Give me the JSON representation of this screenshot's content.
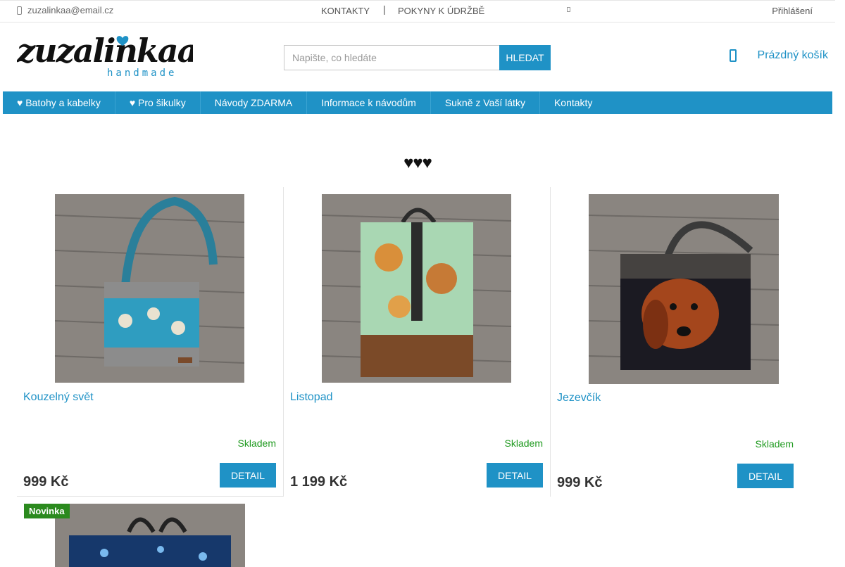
{
  "topbar": {
    "email": "zuzalinkaa@email.cz",
    "link_contacts": "KONTAKTY",
    "separator": "|",
    "link_care": "POKYNY K ÚDRŽBĚ",
    "login": "Přihlášení"
  },
  "header": {
    "logo_text": "zuzalinkaa",
    "logo_subtext": "handmade",
    "search_placeholder": "Napište, co hledáte",
    "search_button": "HLEDAT",
    "cart_label": "Prázdný košík"
  },
  "nav": {
    "items": [
      "♥ Batohy a kabelky",
      "♥ Pro šikulky",
      "Návody ZDARMA",
      "Informace k návodům",
      "Sukně z Vaší látky",
      "Kontakty"
    ]
  },
  "section_heading": "♥♥♥",
  "products": [
    {
      "title": "Kouzelný svět",
      "stock": "Skladem",
      "price": "999 Kč",
      "button": "DETAIL"
    },
    {
      "title": "Listopad",
      "stock": "Skladem",
      "price": "1 199 Kč",
      "button": "DETAIL"
    },
    {
      "title": "Jezevčík",
      "stock": "Skladem",
      "price": "999 Kč",
      "button": "DETAIL"
    }
  ],
  "product4": {
    "badge": "Novinka"
  },
  "colors": {
    "accent": "#1f92c6",
    "stock_green": "#1f9a1f",
    "badge_green": "#2b8a1e"
  }
}
